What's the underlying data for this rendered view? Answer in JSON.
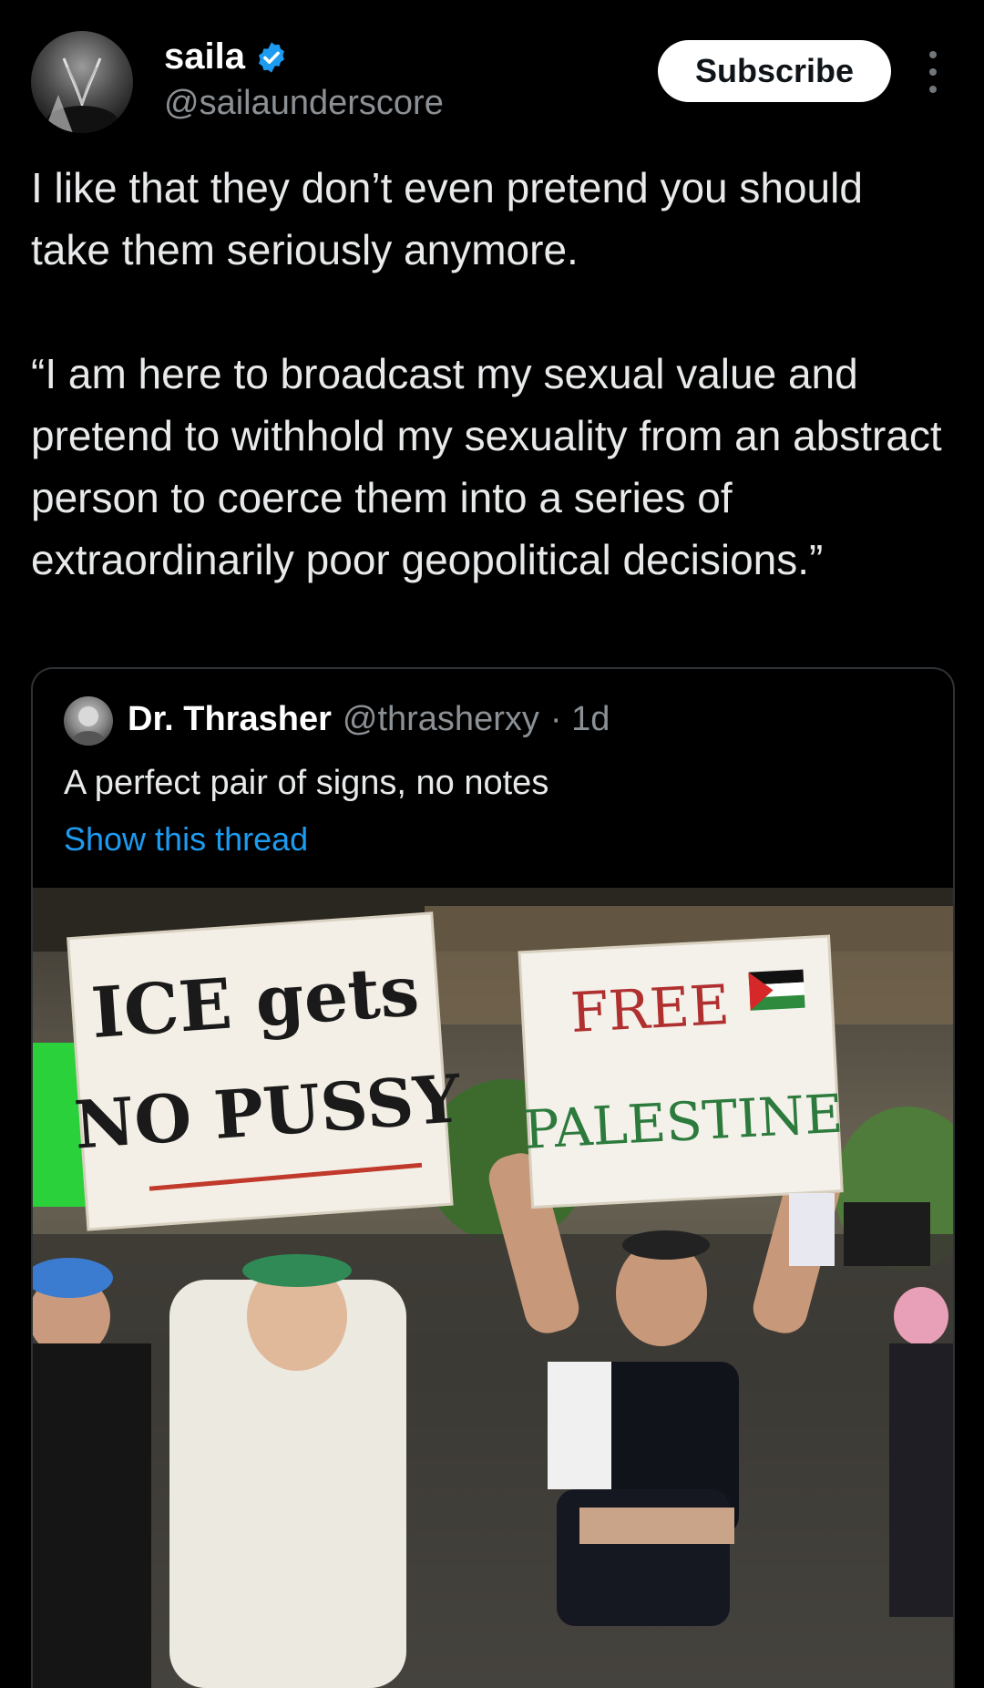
{
  "author": {
    "display_name": "saila",
    "handle": "@sailaunderscore",
    "verified_color": "#1d9bf0",
    "avatar_icon": "avatar-image"
  },
  "actions": {
    "subscribe_label": "Subscribe",
    "more_icon": "more-vertical-icon"
  },
  "tweet": {
    "text": "I like that they don’t even pretend you should take them seriously anymore.\n\n“I am here to broadcast my sexual value and pretend to withhold my sexuality from an abstract person to coerce them into a series of extraordinarily poor geopolitical decisions.”"
  },
  "quoted_tweet": {
    "display_name": "Dr. Thrasher",
    "handle": "@thrasherxy",
    "age": "· 1d",
    "text": "A perfect pair of signs, no notes",
    "thread_link": "Show this thread",
    "photo": {
      "sign_left_line1": "ICE gets",
      "sign_left_line2": "NO PUSSY",
      "sign_right_line1": "FREE",
      "sign_right_line2": "PALESTINE"
    }
  },
  "colors": {
    "background": "#000000",
    "text": "#e7e9ea",
    "muted": "#8b9095",
    "link": "#1d9bf0",
    "border": "#2f3336"
  }
}
